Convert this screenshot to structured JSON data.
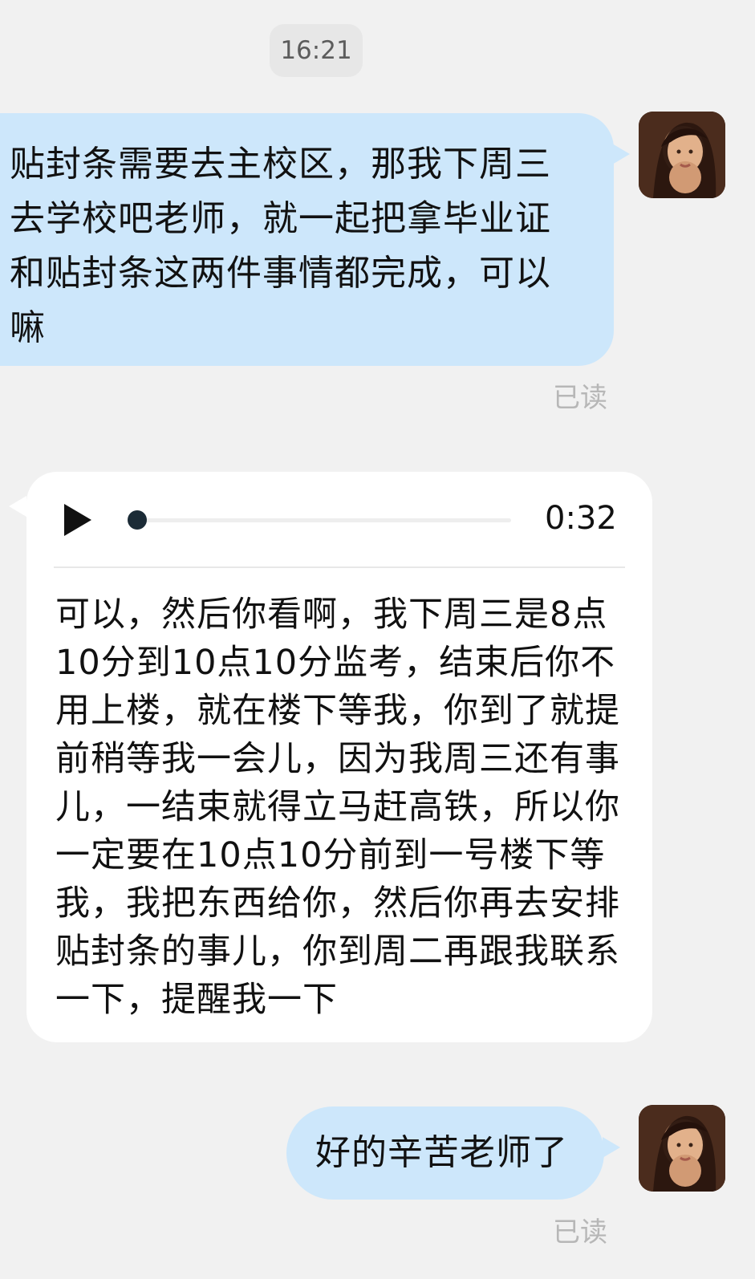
{
  "chat": {
    "timestamp": "16:21",
    "messages": [
      {
        "side": "right",
        "type": "text",
        "text": "贴封条需要去主校区，那我下周三去学校吧老师，就一起把拿毕业证和贴封条这两件事情都完成，可以嘛",
        "status": "已读"
      },
      {
        "side": "left",
        "type": "voice",
        "duration": "0:32",
        "progress": 0.0,
        "transcript": "可以，然后你看啊，我下周三是8点10分到10点10分监考，结束后你不用上楼，就在楼下等我，你到了就提前稍等我一会儿，因为我周三还有事儿，一结束就得立马赶高铁，所以你一定要在10点10分前到一号楼下等我，我把东西给你，然后你再去安排贴封条的事儿，你到周二再跟我联系一下，提醒我一下"
      },
      {
        "side": "right",
        "type": "text",
        "text": "好的辛苦老师了",
        "status": "已读"
      }
    ]
  },
  "icons": {
    "play": "play-icon",
    "avatar": "avatar-photo"
  },
  "colors": {
    "background": "#f1f1f1",
    "outgoing_bubble": "#cde7fb",
    "incoming_bubble": "#ffffff",
    "read_status": "#b7b7b7"
  }
}
